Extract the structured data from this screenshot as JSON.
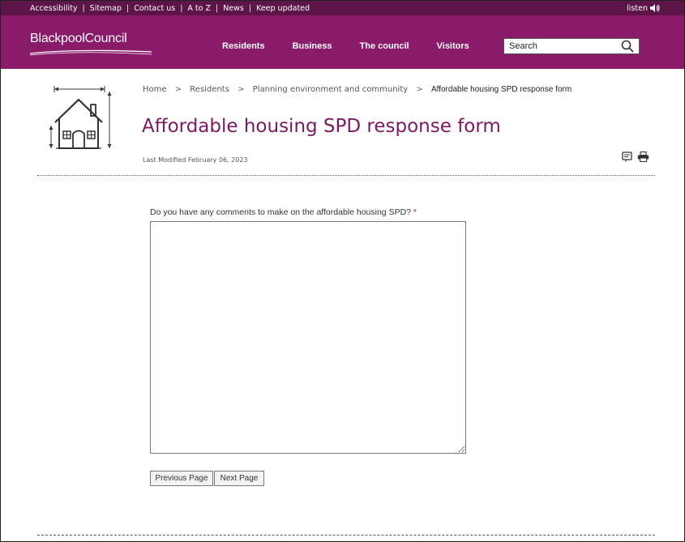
{
  "utility_bar": {
    "links": [
      "Accessibility",
      "Sitemap",
      "Contact us",
      "A to Z",
      "News",
      "Keep updated"
    ],
    "separator": "|",
    "listen_label": "listen"
  },
  "header": {
    "logo_text": "BlackpoolCouncil",
    "nav": [
      "Residents",
      "Business",
      "The council",
      "Visitors"
    ],
    "search_placeholder": "Search"
  },
  "breadcrumb": {
    "items": [
      "Home",
      "Residents",
      "Planning environment and community",
      "Affordable housing SPD response form"
    ],
    "separator": ">"
  },
  "page": {
    "title": "Affordable housing SPD response form",
    "last_modified": "Last Modified February 06, 2023"
  },
  "form": {
    "question": "Do you have any comments to make on the affordable housing SPD?",
    "required_marker": "*",
    "comments_value": "",
    "previous_button": "Previous Page",
    "next_button": "Next Page"
  },
  "colors": {
    "header_bg": "#8a1a6a",
    "topbar_bg": "#5d1449",
    "title": "#7b1a63",
    "required": "#b0263e"
  },
  "icons": [
    "speaker-icon",
    "search-icon",
    "house-icon",
    "format-icon",
    "print-icon"
  ]
}
